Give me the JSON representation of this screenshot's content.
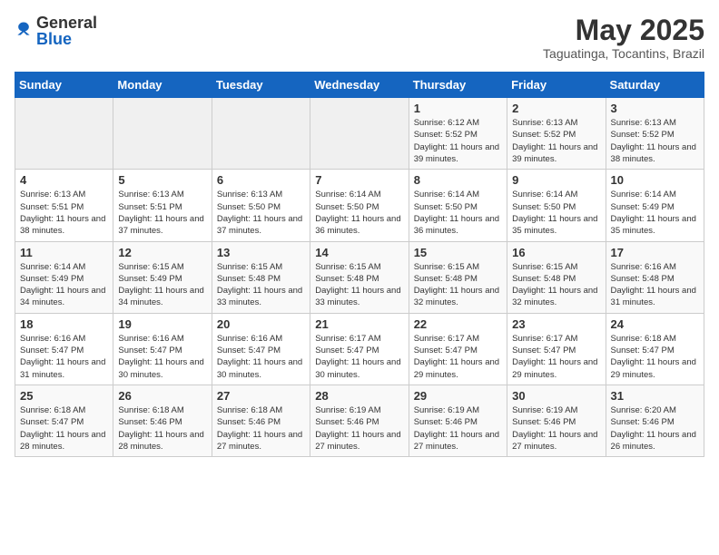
{
  "header": {
    "logo_general": "General",
    "logo_blue": "Blue",
    "month_year": "May 2025",
    "location": "Taguatinga, Tocantins, Brazil"
  },
  "days_of_week": [
    "Sunday",
    "Monday",
    "Tuesday",
    "Wednesday",
    "Thursday",
    "Friday",
    "Saturday"
  ],
  "weeks": [
    [
      {
        "day": "",
        "info": ""
      },
      {
        "day": "",
        "info": ""
      },
      {
        "day": "",
        "info": ""
      },
      {
        "day": "",
        "info": ""
      },
      {
        "day": "1",
        "info": "Sunrise: 6:12 AM\nSunset: 5:52 PM\nDaylight: 11 hours and 39 minutes."
      },
      {
        "day": "2",
        "info": "Sunrise: 6:13 AM\nSunset: 5:52 PM\nDaylight: 11 hours and 39 minutes."
      },
      {
        "day": "3",
        "info": "Sunrise: 6:13 AM\nSunset: 5:52 PM\nDaylight: 11 hours and 38 minutes."
      }
    ],
    [
      {
        "day": "4",
        "info": "Sunrise: 6:13 AM\nSunset: 5:51 PM\nDaylight: 11 hours and 38 minutes."
      },
      {
        "day": "5",
        "info": "Sunrise: 6:13 AM\nSunset: 5:51 PM\nDaylight: 11 hours and 37 minutes."
      },
      {
        "day": "6",
        "info": "Sunrise: 6:13 AM\nSunset: 5:50 PM\nDaylight: 11 hours and 37 minutes."
      },
      {
        "day": "7",
        "info": "Sunrise: 6:14 AM\nSunset: 5:50 PM\nDaylight: 11 hours and 36 minutes."
      },
      {
        "day": "8",
        "info": "Sunrise: 6:14 AM\nSunset: 5:50 PM\nDaylight: 11 hours and 36 minutes."
      },
      {
        "day": "9",
        "info": "Sunrise: 6:14 AM\nSunset: 5:50 PM\nDaylight: 11 hours and 35 minutes."
      },
      {
        "day": "10",
        "info": "Sunrise: 6:14 AM\nSunset: 5:49 PM\nDaylight: 11 hours and 35 minutes."
      }
    ],
    [
      {
        "day": "11",
        "info": "Sunrise: 6:14 AM\nSunset: 5:49 PM\nDaylight: 11 hours and 34 minutes."
      },
      {
        "day": "12",
        "info": "Sunrise: 6:15 AM\nSunset: 5:49 PM\nDaylight: 11 hours and 34 minutes."
      },
      {
        "day": "13",
        "info": "Sunrise: 6:15 AM\nSunset: 5:48 PM\nDaylight: 11 hours and 33 minutes."
      },
      {
        "day": "14",
        "info": "Sunrise: 6:15 AM\nSunset: 5:48 PM\nDaylight: 11 hours and 33 minutes."
      },
      {
        "day": "15",
        "info": "Sunrise: 6:15 AM\nSunset: 5:48 PM\nDaylight: 11 hours and 32 minutes."
      },
      {
        "day": "16",
        "info": "Sunrise: 6:15 AM\nSunset: 5:48 PM\nDaylight: 11 hours and 32 minutes."
      },
      {
        "day": "17",
        "info": "Sunrise: 6:16 AM\nSunset: 5:48 PM\nDaylight: 11 hours and 31 minutes."
      }
    ],
    [
      {
        "day": "18",
        "info": "Sunrise: 6:16 AM\nSunset: 5:47 PM\nDaylight: 11 hours and 31 minutes."
      },
      {
        "day": "19",
        "info": "Sunrise: 6:16 AM\nSunset: 5:47 PM\nDaylight: 11 hours and 30 minutes."
      },
      {
        "day": "20",
        "info": "Sunrise: 6:16 AM\nSunset: 5:47 PM\nDaylight: 11 hours and 30 minutes."
      },
      {
        "day": "21",
        "info": "Sunrise: 6:17 AM\nSunset: 5:47 PM\nDaylight: 11 hours and 30 minutes."
      },
      {
        "day": "22",
        "info": "Sunrise: 6:17 AM\nSunset: 5:47 PM\nDaylight: 11 hours and 29 minutes."
      },
      {
        "day": "23",
        "info": "Sunrise: 6:17 AM\nSunset: 5:47 PM\nDaylight: 11 hours and 29 minutes."
      },
      {
        "day": "24",
        "info": "Sunrise: 6:18 AM\nSunset: 5:47 PM\nDaylight: 11 hours and 29 minutes."
      }
    ],
    [
      {
        "day": "25",
        "info": "Sunrise: 6:18 AM\nSunset: 5:47 PM\nDaylight: 11 hours and 28 minutes."
      },
      {
        "day": "26",
        "info": "Sunrise: 6:18 AM\nSunset: 5:46 PM\nDaylight: 11 hours and 28 minutes."
      },
      {
        "day": "27",
        "info": "Sunrise: 6:18 AM\nSunset: 5:46 PM\nDaylight: 11 hours and 27 minutes."
      },
      {
        "day": "28",
        "info": "Sunrise: 6:19 AM\nSunset: 5:46 PM\nDaylight: 11 hours and 27 minutes."
      },
      {
        "day": "29",
        "info": "Sunrise: 6:19 AM\nSunset: 5:46 PM\nDaylight: 11 hours and 27 minutes."
      },
      {
        "day": "30",
        "info": "Sunrise: 6:19 AM\nSunset: 5:46 PM\nDaylight: 11 hours and 27 minutes."
      },
      {
        "day": "31",
        "info": "Sunrise: 6:20 AM\nSunset: 5:46 PM\nDaylight: 11 hours and 26 minutes."
      }
    ]
  ]
}
